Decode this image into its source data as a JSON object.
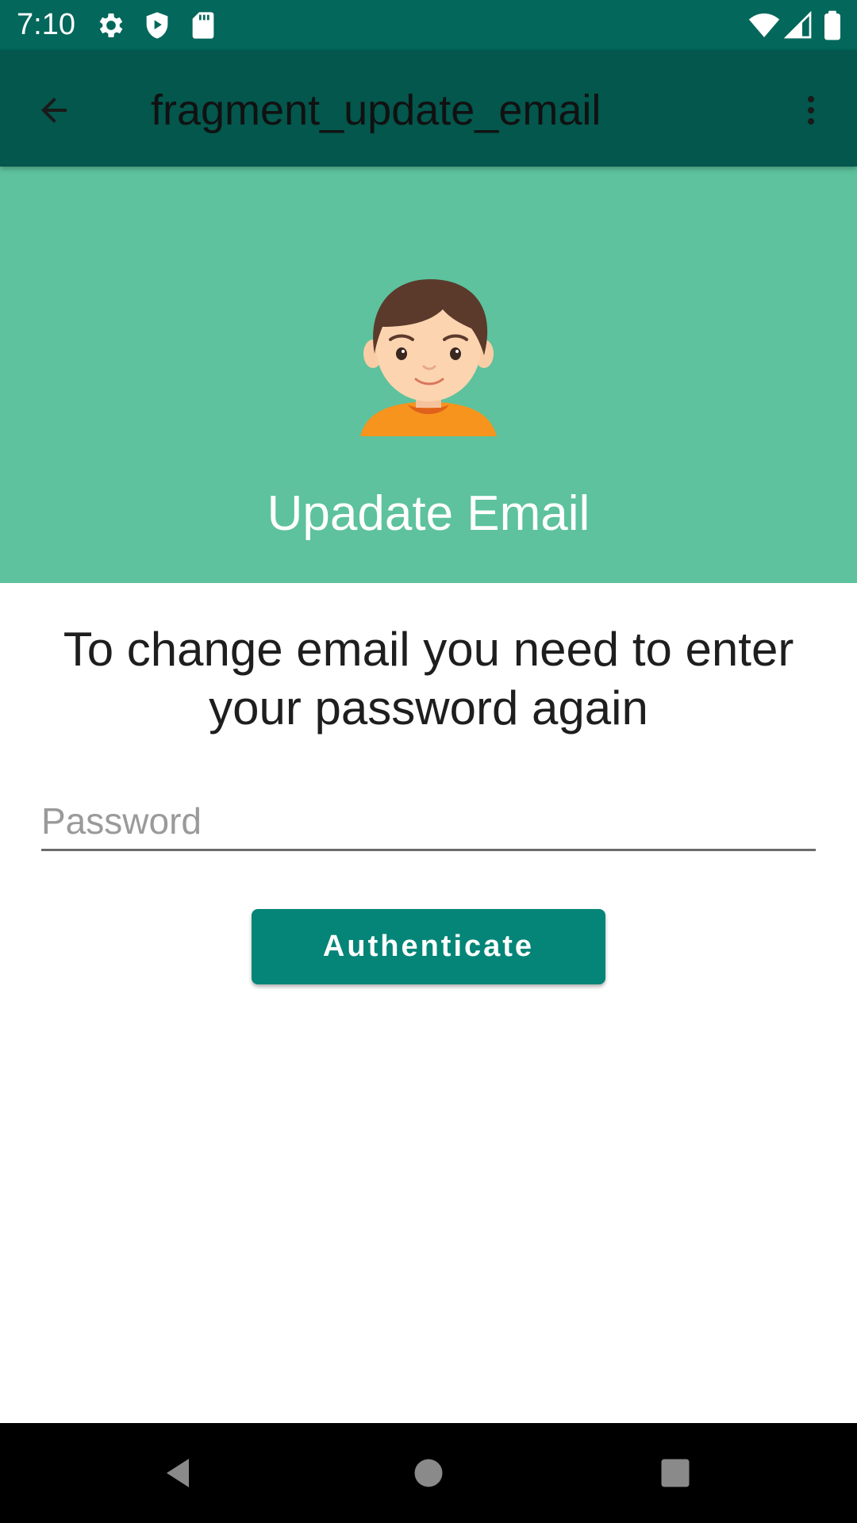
{
  "status_bar": {
    "time": "7:10",
    "icons": [
      "gear-icon",
      "shield-play-icon",
      "sd-card-icon",
      "wifi-icon",
      "signal-icon",
      "battery-icon"
    ]
  },
  "app_bar": {
    "title": "fragment_update_email",
    "back_icon": "arrow-back-icon",
    "menu_icon": "more-vert-icon"
  },
  "hero": {
    "title": "Upadate Email",
    "avatar": "avatar-boy-icon"
  },
  "content": {
    "instruction": "To change email you need to enter your password again",
    "password": {
      "value": "",
      "placeholder": "Password"
    },
    "authenticate_label": "Authenticate"
  },
  "colors": {
    "status_bar": "#03675b",
    "app_bar": "#03574d",
    "hero": "#5dc29d",
    "button": "#048577"
  },
  "nav_bar": {
    "icons": [
      "nav-back-icon",
      "nav-home-icon",
      "nav-recents-icon"
    ]
  }
}
